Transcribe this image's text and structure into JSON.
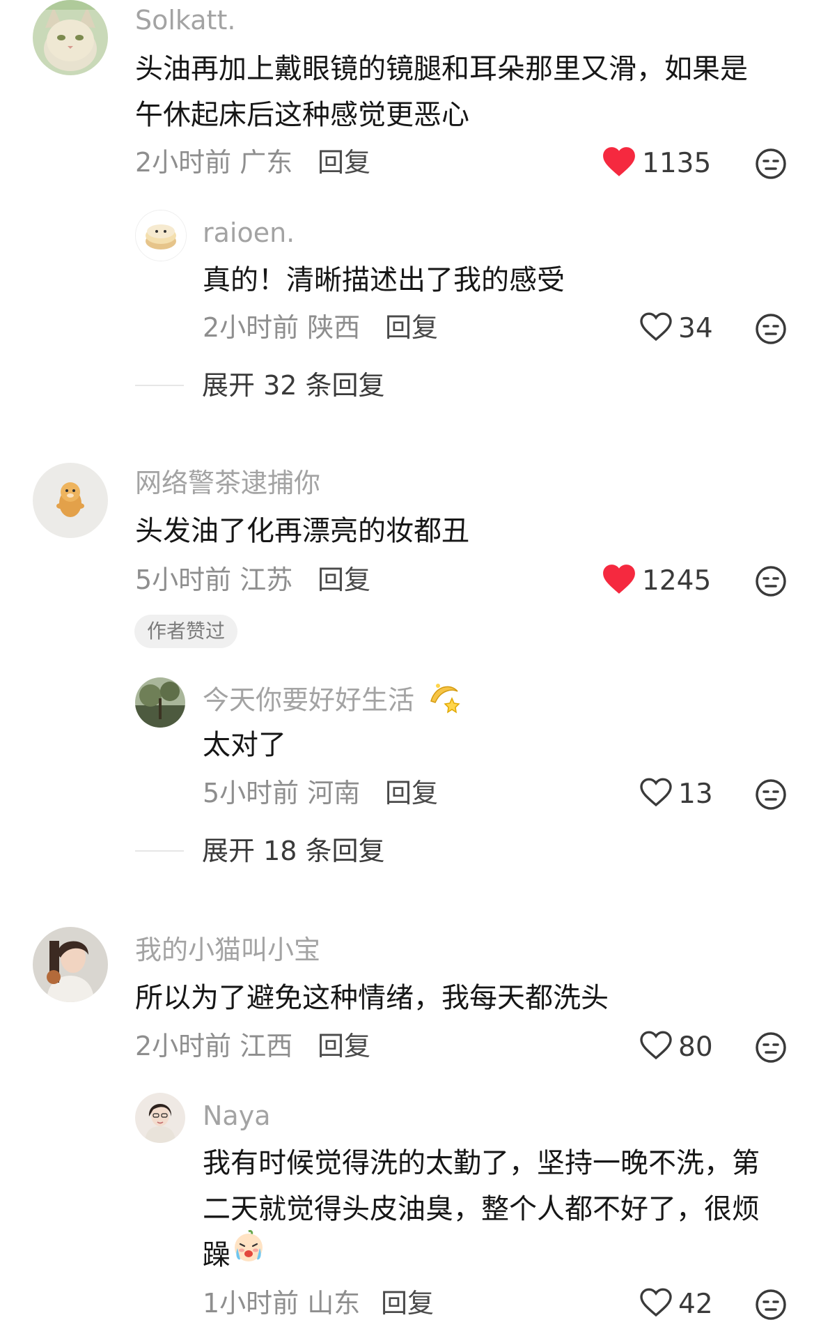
{
  "colors": {
    "liked_heart": "#f5293f",
    "outline_icon": "#3a3a3a",
    "username": "#a3a3a3",
    "meta": "#8e8e8e"
  },
  "comments": [
    {
      "username": "Solkatt.",
      "lines": [
        "头油再加上戴眼镜的镜腿和耳朵那里又滑，如果是",
        "午休起床后这种感觉更恶心"
      ],
      "time": "2小时前",
      "location": "广东",
      "reply_label": "回复",
      "likes": "1135",
      "liked": true,
      "replies": [
        {
          "username": "raioen.",
          "lines": [
            "真的！清晰描述出了我的感受"
          ],
          "time": "2小时前",
          "location": "陕西",
          "reply_label": "回复",
          "likes": "34",
          "liked": false
        }
      ],
      "expand_label": "展开 32 条回复"
    },
    {
      "username": "网络警茶逮捕你",
      "lines": [
        "头发油了化再漂亮的妆都丑"
      ],
      "time": "5小时前",
      "location": "江苏",
      "reply_label": "回复",
      "likes": "1245",
      "liked": true,
      "badge": "作者赞过",
      "replies": [
        {
          "username": "今天你要好好生活",
          "username_emoji": "dizzy-emoji",
          "lines": [
            "太对了"
          ],
          "time": "5小时前",
          "location": "河南",
          "reply_label": "回复",
          "likes": "13",
          "liked": false
        }
      ],
      "expand_label": "展开 18 条回复"
    },
    {
      "username": "我的小猫叫小宝",
      "lines": [
        "所以为了避免这种情绪，我每天都洗头"
      ],
      "time": "2小时前",
      "location": "江西",
      "reply_label": "回复",
      "likes": "80",
      "liked": false,
      "replies": [
        {
          "username": "Naya",
          "lines": [
            "我有时候觉得洗的太勤了，坚持一晚不洗，第",
            "二天就觉得头皮油臭，整个人都不好了，很烦",
            "躁"
          ],
          "trailing_emoji": "crying-face-emoji",
          "time": "1小时前",
          "location": "山东",
          "reply_label": "回复",
          "likes": "42",
          "liked": false
        }
      ]
    }
  ],
  "icons": {
    "heart": "heart-icon",
    "dislike": "dislike-face-icon"
  }
}
